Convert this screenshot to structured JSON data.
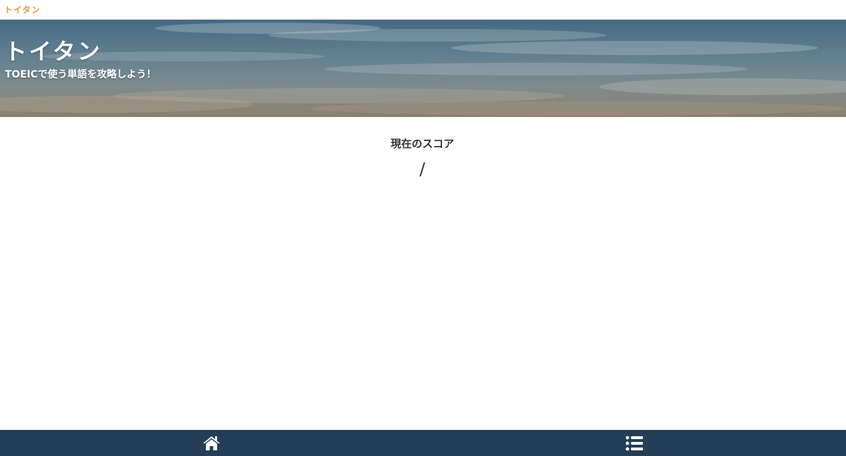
{
  "topbar": {
    "logo_text": "トイタン"
  },
  "hero": {
    "title": "トイタン",
    "subtitle": "TOEICで使う単語を攻略しよう！"
  },
  "score": {
    "label": "現在のスコア",
    "value": "/"
  },
  "bottom_nav": {
    "items": [
      {
        "name": "home",
        "icon": "home-icon"
      },
      {
        "name": "list",
        "icon": "list-icon"
      }
    ]
  },
  "colors": {
    "brand_orange": "#e8973a",
    "nav_background": "#243e58",
    "text_dark": "#333333"
  }
}
